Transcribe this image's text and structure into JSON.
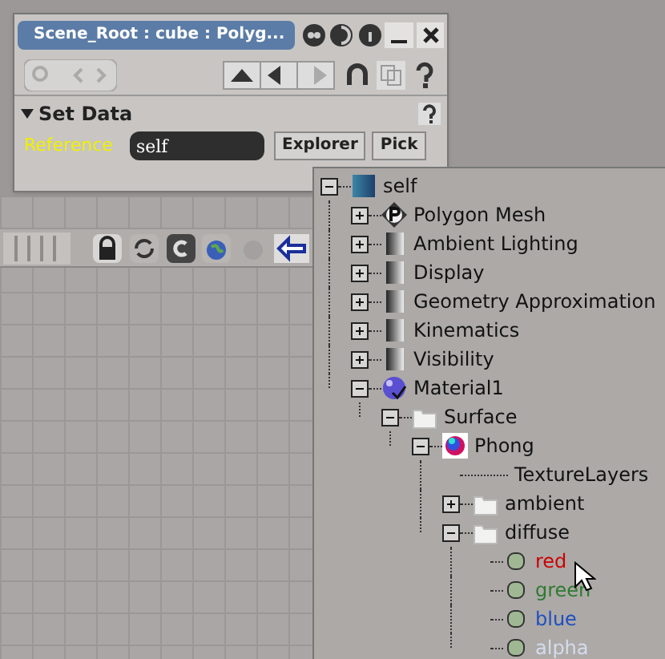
{
  "panel": {
    "title": "Scene_Root : cube : Polyg...",
    "section": {
      "title": "Set Data",
      "expanded": true
    },
    "reference": {
      "label": "Reference",
      "value": "self"
    },
    "buttons": [
      "Explorer",
      "Pick"
    ]
  },
  "tree": [
    {
      "label": "self",
      "kind": "root",
      "expanded": true,
      "children": [
        {
          "label": "Polygon Mesh",
          "kind": "mesh",
          "expanded": false
        },
        {
          "label": "Ambient Lighting",
          "kind": "shaded",
          "expanded": false
        },
        {
          "label": "Display",
          "kind": "shaded",
          "expanded": false
        },
        {
          "label": "Geometry Approximation",
          "kind": "shaded",
          "expanded": false
        },
        {
          "label": "Kinematics",
          "kind": "shaded",
          "expanded": false
        },
        {
          "label": "Visibility",
          "kind": "shaded",
          "expanded": false
        },
        {
          "label": "Material1",
          "kind": "material",
          "expanded": true,
          "children": [
            {
              "label": "Surface",
              "kind": "folder",
              "expanded": true,
              "children": [
                {
                  "label": "Phong",
                  "kind": "phong",
                  "expanded": true,
                  "children": [
                    {
                      "label": "TextureLayers",
                      "kind": "plain"
                    },
                    {
                      "label": "ambient",
                      "kind": "folder",
                      "expanded": false
                    },
                    {
                      "label": "diffuse",
                      "kind": "folder",
                      "expanded": true,
                      "children": [
                        {
                          "label": "red",
                          "kind": "channel",
                          "color": "#cc0000"
                        },
                        {
                          "label": "green",
                          "kind": "channel",
                          "color": "#2f7a2f"
                        },
                        {
                          "label": "blue",
                          "kind": "channel",
                          "color": "#1f4fc0"
                        },
                        {
                          "label": "alpha",
                          "kind": "channel",
                          "color": "#d4dcec"
                        }
                      ]
                    }
                  ]
                }
              ]
            }
          ]
        }
      ]
    }
  ]
}
